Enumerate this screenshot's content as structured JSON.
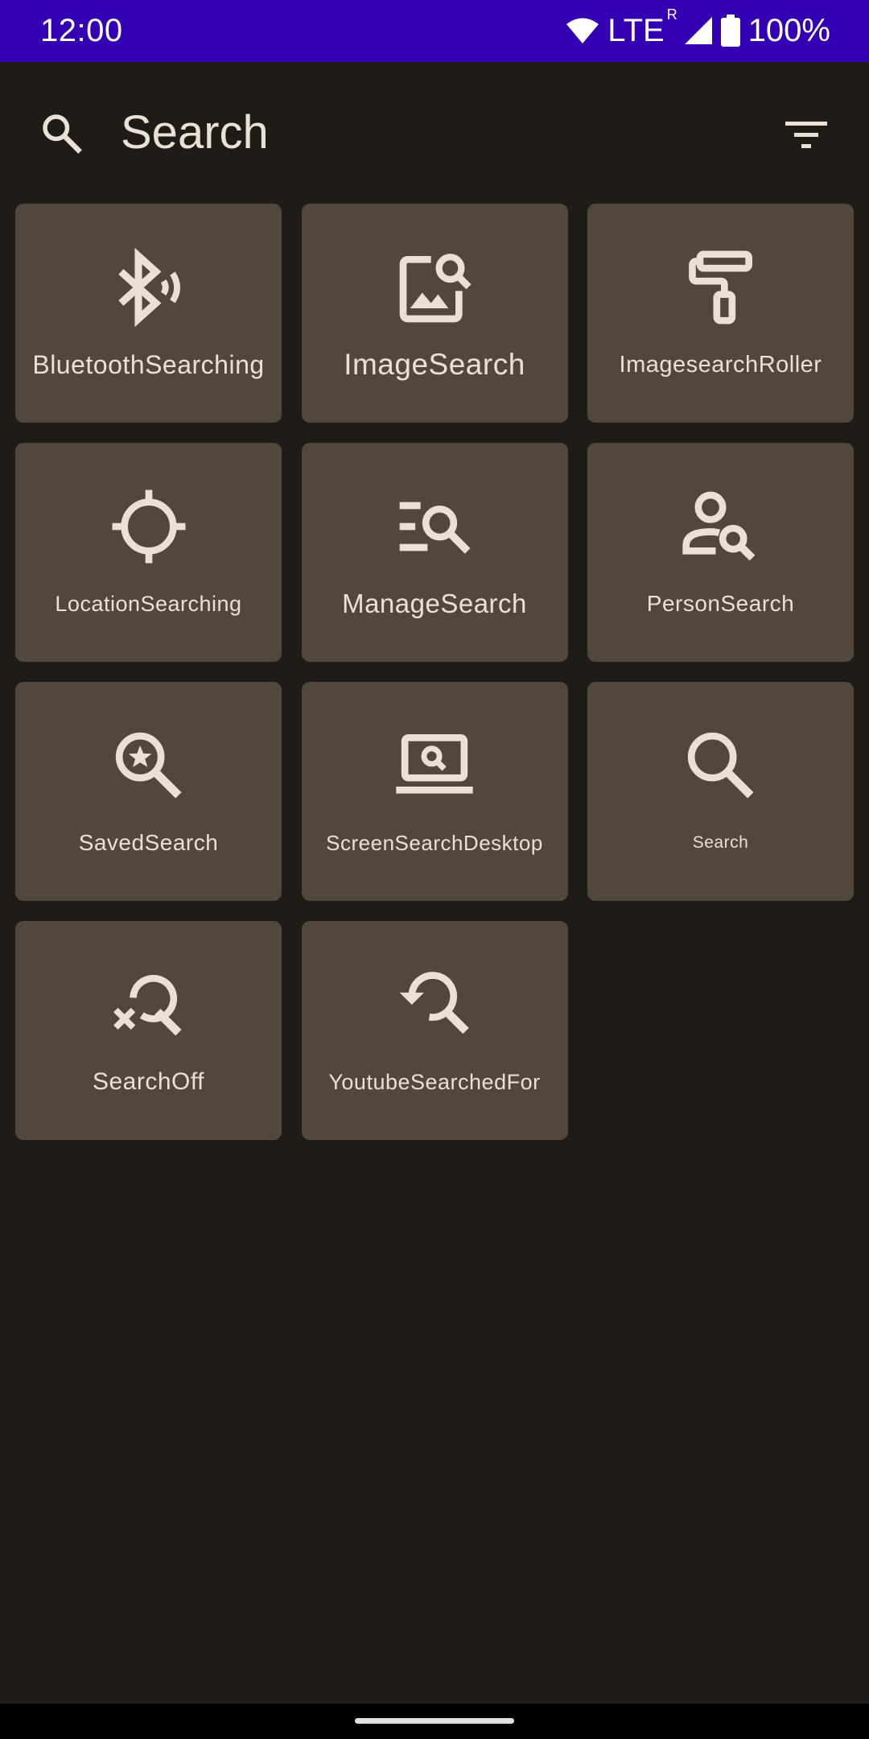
{
  "status_bar": {
    "time": "12:00",
    "network": "LTE",
    "roaming": "R",
    "battery": "100%"
  },
  "search": {
    "placeholder": "Search",
    "value": ""
  },
  "icons": [
    {
      "label": "BluetoothSearching",
      "icon": "bluetooth-searching-icon"
    },
    {
      "label": "ImageSearch",
      "icon": "image-search-icon"
    },
    {
      "label": "ImagesearchRoller",
      "icon": "imagesearch-roller-icon"
    },
    {
      "label": "LocationSearching",
      "icon": "location-searching-icon"
    },
    {
      "label": "ManageSearch",
      "icon": "manage-search-icon"
    },
    {
      "label": "PersonSearch",
      "icon": "person-search-icon"
    },
    {
      "label": "SavedSearch",
      "icon": "saved-search-icon"
    },
    {
      "label": "ScreenSearchDesktop",
      "icon": "screen-search-desktop-icon"
    },
    {
      "label": "Search",
      "icon": "search-icon"
    },
    {
      "label": "SearchOff",
      "icon": "search-off-icon"
    },
    {
      "label": "YoutubeSearchedFor",
      "icon": "youtube-searched-for-icon"
    }
  ],
  "colors": {
    "status_bar": "#3300b3",
    "background": "#1f1b16",
    "tile": "#51473c",
    "foreground": "#ebe0d6"
  }
}
